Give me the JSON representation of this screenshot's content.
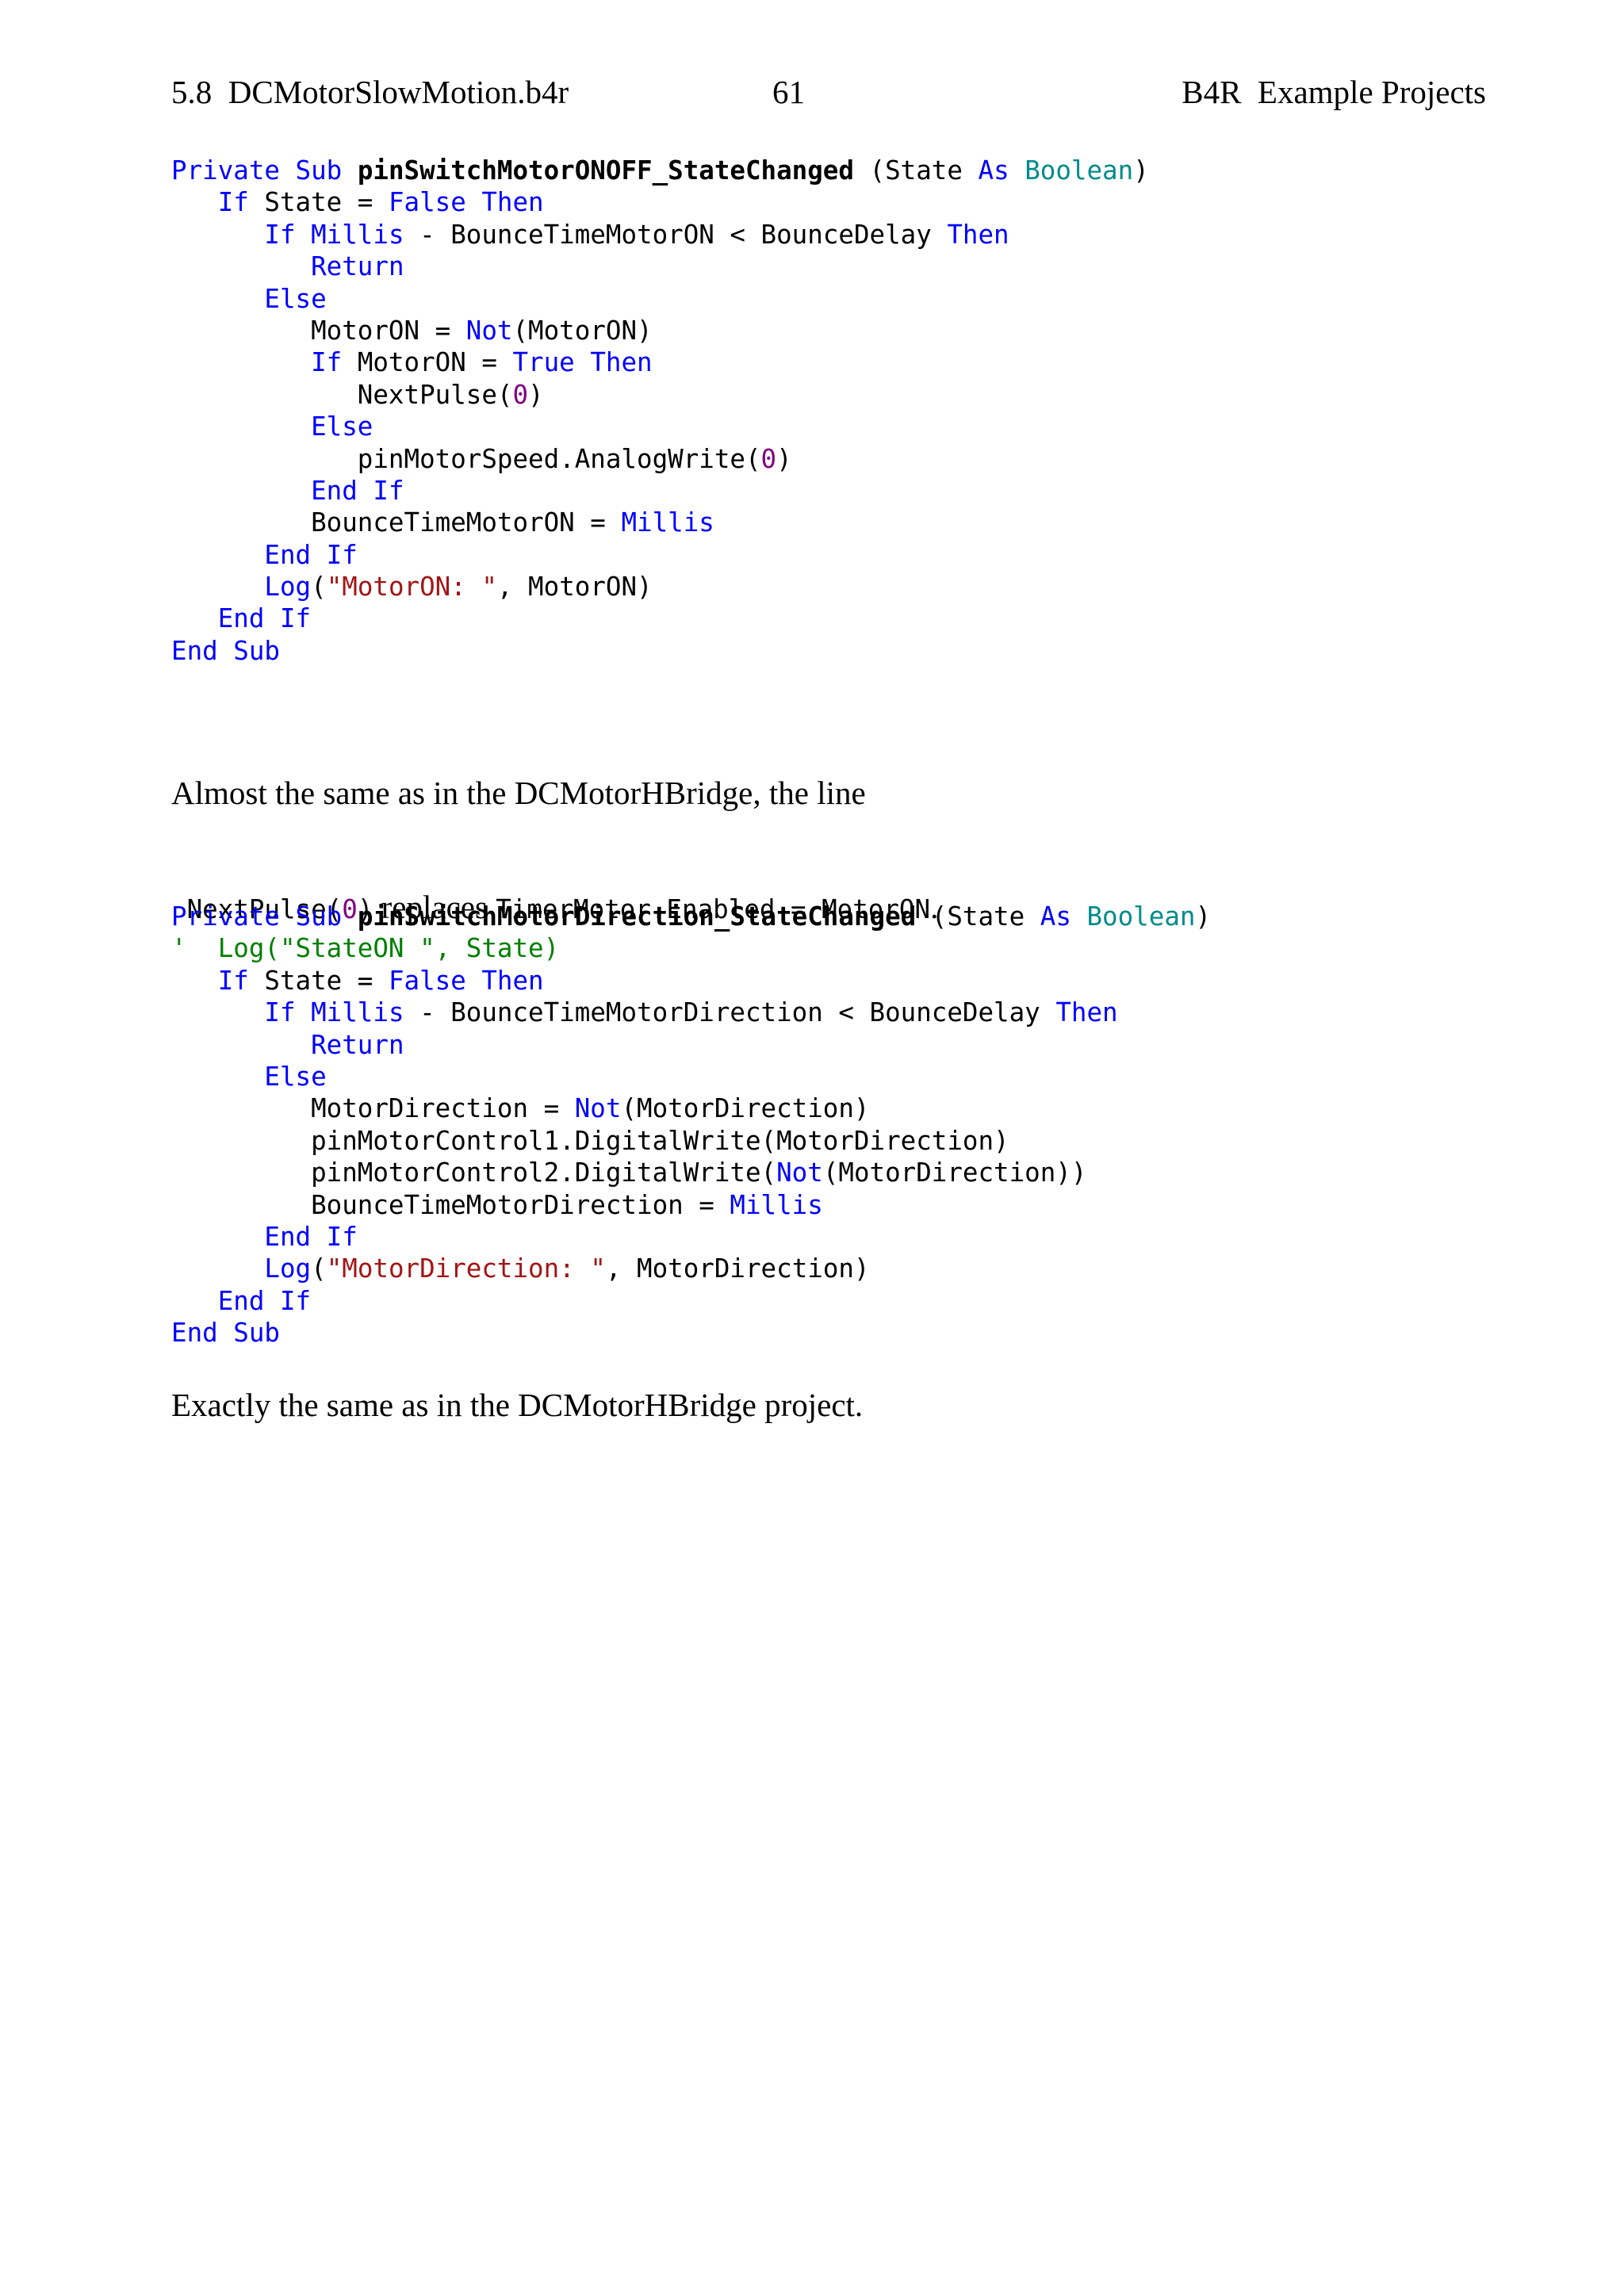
{
  "header": {
    "section": "5.8  DCMotorSlowMotion.b4r",
    "page_number": "61",
    "book_title": "B4R  Example Projects"
  },
  "code_block_1": [
    [
      {
        "t": "Private Sub ",
        "c": "kw"
      },
      {
        "t": "pinSwitchMotorONOFF_StateChanged",
        "c": "fn"
      },
      {
        "t": " (State ",
        "c": ""
      },
      {
        "t": "As",
        "c": "kw"
      },
      {
        "t": " ",
        "c": ""
      },
      {
        "t": "Boolean",
        "c": "ty"
      },
      {
        "t": ")",
        "c": ""
      }
    ],
    [
      {
        "t": "   ",
        "c": ""
      },
      {
        "t": "If",
        "c": "kw"
      },
      {
        "t": " State = ",
        "c": ""
      },
      {
        "t": "False Then",
        "c": "kw"
      }
    ],
    [
      {
        "t": "      ",
        "c": ""
      },
      {
        "t": "If Millis",
        "c": "kw"
      },
      {
        "t": " - BounceTimeMotorON < BounceDelay ",
        "c": ""
      },
      {
        "t": "Then",
        "c": "kw"
      }
    ],
    [
      {
        "t": "         ",
        "c": ""
      },
      {
        "t": "Return",
        "c": "kw"
      }
    ],
    [
      {
        "t": "      ",
        "c": ""
      },
      {
        "t": "Else",
        "c": "kw"
      }
    ],
    [
      {
        "t": "         MotorON = ",
        "c": ""
      },
      {
        "t": "Not",
        "c": "kw"
      },
      {
        "t": "(MotorON)",
        "c": ""
      }
    ],
    [
      {
        "t": "         ",
        "c": ""
      },
      {
        "t": "If",
        "c": "kw"
      },
      {
        "t": " MotorON = ",
        "c": ""
      },
      {
        "t": "True Then",
        "c": "kw"
      }
    ],
    [
      {
        "t": "            NextPulse(",
        "c": ""
      },
      {
        "t": "0",
        "c": "num"
      },
      {
        "t": ")",
        "c": ""
      }
    ],
    [
      {
        "t": "         ",
        "c": ""
      },
      {
        "t": "Else",
        "c": "kw"
      }
    ],
    [
      {
        "t": "            pinMotorSpeed.AnalogWrite(",
        "c": ""
      },
      {
        "t": "0",
        "c": "num"
      },
      {
        "t": ")",
        "c": ""
      }
    ],
    [
      {
        "t": "         ",
        "c": ""
      },
      {
        "t": "End If",
        "c": "kw"
      }
    ],
    [
      {
        "t": "         BounceTimeMotorON = ",
        "c": ""
      },
      {
        "t": "Millis",
        "c": "kw"
      }
    ],
    [
      {
        "t": "      ",
        "c": ""
      },
      {
        "t": "End If",
        "c": "kw"
      }
    ],
    [
      {
        "t": "      ",
        "c": ""
      },
      {
        "t": "Log",
        "c": "kw"
      },
      {
        "t": "(",
        "c": ""
      },
      {
        "t": "\"MotorON: \"",
        "c": "str"
      },
      {
        "t": ", MotorON)",
        "c": ""
      }
    ],
    [
      {
        "t": "   ",
        "c": ""
      },
      {
        "t": "End If",
        "c": "kw"
      }
    ],
    [
      {
        "t": "End Sub",
        "c": "kw"
      }
    ]
  ],
  "paragraph_1": {
    "line1": "Almost the same as in the DCMotorHBridge, the line",
    "code_a_pre": "NextPulse(",
    "code_a_num": "0",
    "code_a_post": ")",
    "mid_text": " replaces ",
    "code_b": "TimerMotor.Enabled = MotorON",
    "end_text": "."
  },
  "code_block_2": [
    [
      {
        "t": "Private Sub ",
        "c": "kw"
      },
      {
        "t": "pinSwitchMotorDirection_StateChanged",
        "c": "fn"
      },
      {
        "t": " (State ",
        "c": ""
      },
      {
        "t": "As",
        "c": "kw"
      },
      {
        "t": " ",
        "c": ""
      },
      {
        "t": "Boolean",
        "c": "ty"
      },
      {
        "t": ")",
        "c": ""
      }
    ],
    [
      {
        "t": "'  Log(\"StateON \", State)",
        "c": "cm"
      }
    ],
    [
      {
        "t": "   ",
        "c": ""
      },
      {
        "t": "If",
        "c": "kw"
      },
      {
        "t": " State = ",
        "c": ""
      },
      {
        "t": "False Then",
        "c": "kw"
      }
    ],
    [
      {
        "t": "      ",
        "c": ""
      },
      {
        "t": "If Millis",
        "c": "kw"
      },
      {
        "t": " - BounceTimeMotorDirection < BounceDelay ",
        "c": ""
      },
      {
        "t": "Then",
        "c": "kw"
      }
    ],
    [
      {
        "t": "         ",
        "c": ""
      },
      {
        "t": "Return",
        "c": "kw"
      }
    ],
    [
      {
        "t": "      ",
        "c": ""
      },
      {
        "t": "Else",
        "c": "kw"
      }
    ],
    [
      {
        "t": "         MotorDirection = ",
        "c": ""
      },
      {
        "t": "Not",
        "c": "kw"
      },
      {
        "t": "(MotorDirection)",
        "c": ""
      }
    ],
    [
      {
        "t": "         pinMotorControl1.DigitalWrite(MotorDirection)",
        "c": ""
      }
    ],
    [
      {
        "t": "         pinMotorControl2.DigitalWrite(",
        "c": ""
      },
      {
        "t": "Not",
        "c": "kw"
      },
      {
        "t": "(MotorDirection))",
        "c": ""
      }
    ],
    [
      {
        "t": "         BounceTimeMotorDirection = ",
        "c": ""
      },
      {
        "t": "Millis",
        "c": "kw"
      }
    ],
    [
      {
        "t": "      ",
        "c": ""
      },
      {
        "t": "End If",
        "c": "kw"
      }
    ],
    [
      {
        "t": "      ",
        "c": ""
      },
      {
        "t": "Log",
        "c": "kw"
      },
      {
        "t": "(",
        "c": ""
      },
      {
        "t": "\"MotorDirection: \"",
        "c": "str"
      },
      {
        "t": ", MotorDirection)",
        "c": ""
      }
    ],
    [
      {
        "t": "   ",
        "c": ""
      },
      {
        "t": "End If",
        "c": "kw"
      }
    ],
    [
      {
        "t": "End Sub",
        "c": "kw"
      }
    ]
  ],
  "paragraph_2": "Exactly the same as in the DCMotorHBridge project.",
  "colors": {
    "keyword": "#0000ff",
    "type": "#008b8b",
    "string": "#a31515",
    "number": "#800080",
    "comment": "#008000"
  }
}
